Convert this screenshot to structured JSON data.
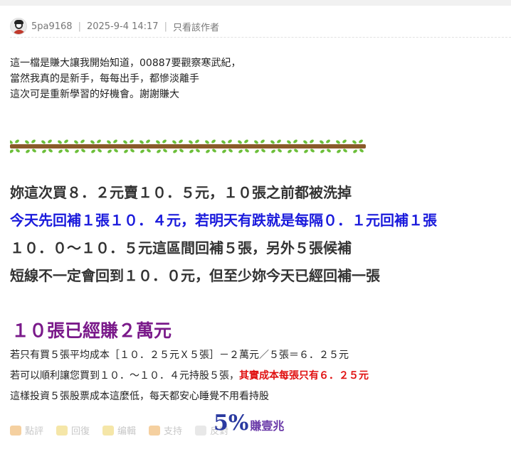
{
  "post": {
    "username": "5pa9168",
    "datetime": "2025-9-4 14:17",
    "separator": "|",
    "author_only": "只看該作者"
  },
  "intro_lines": [
    "這一檔是賺大讓我開始知道，00887要觀察寒武紀，",
    "當然我真的是新手，每每出手，都慘淡離手",
    "這次可是重新學習的好機會。謝謝賺大"
  ],
  "bold_lines": [
    "妳這次買８．２元賣１０．５元，１０張之前都被洗掉",
    "今天先回補１張１０．４元，若明天有跌就是每隔０．１元回補１張",
    "１０．０～１０．５元這區間回補５張，另外５張候補",
    "短線不一定會回到１０．０元，但至少妳今天已經回補一張"
  ],
  "highlight": "１０張已經賺２萬元",
  "detail_lines": {
    "line1": "若只有買５張平均成本［１０．２５元Ｘ５張］－２萬元／５張＝６．２５元",
    "line2_prefix": "若可以順利讓您買到１０．～１０．４元持股５張，",
    "line2_red": "其實成本每張只有６．２５元",
    "line3": "這樣投資５張股票成本這麼低，每天都安心睡覺不用看持股"
  },
  "actions": {
    "comment": "點評",
    "reply": "回復",
    "edit": "编輯",
    "support": "支持",
    "oppose": "反對"
  },
  "logo": {
    "percent": "5%",
    "text": "賺壹兆"
  },
  "colors": {
    "blue_line": "#1a1adc",
    "purple": "#7a1a8a",
    "red": "#e01010",
    "branch": "#8a5a2b",
    "leaf": "#6cbf3a"
  },
  "icons": [
    "avatar",
    "branch-divider",
    "comment-icon",
    "reply-icon",
    "edit-icon",
    "support-icon",
    "oppose-icon"
  ]
}
